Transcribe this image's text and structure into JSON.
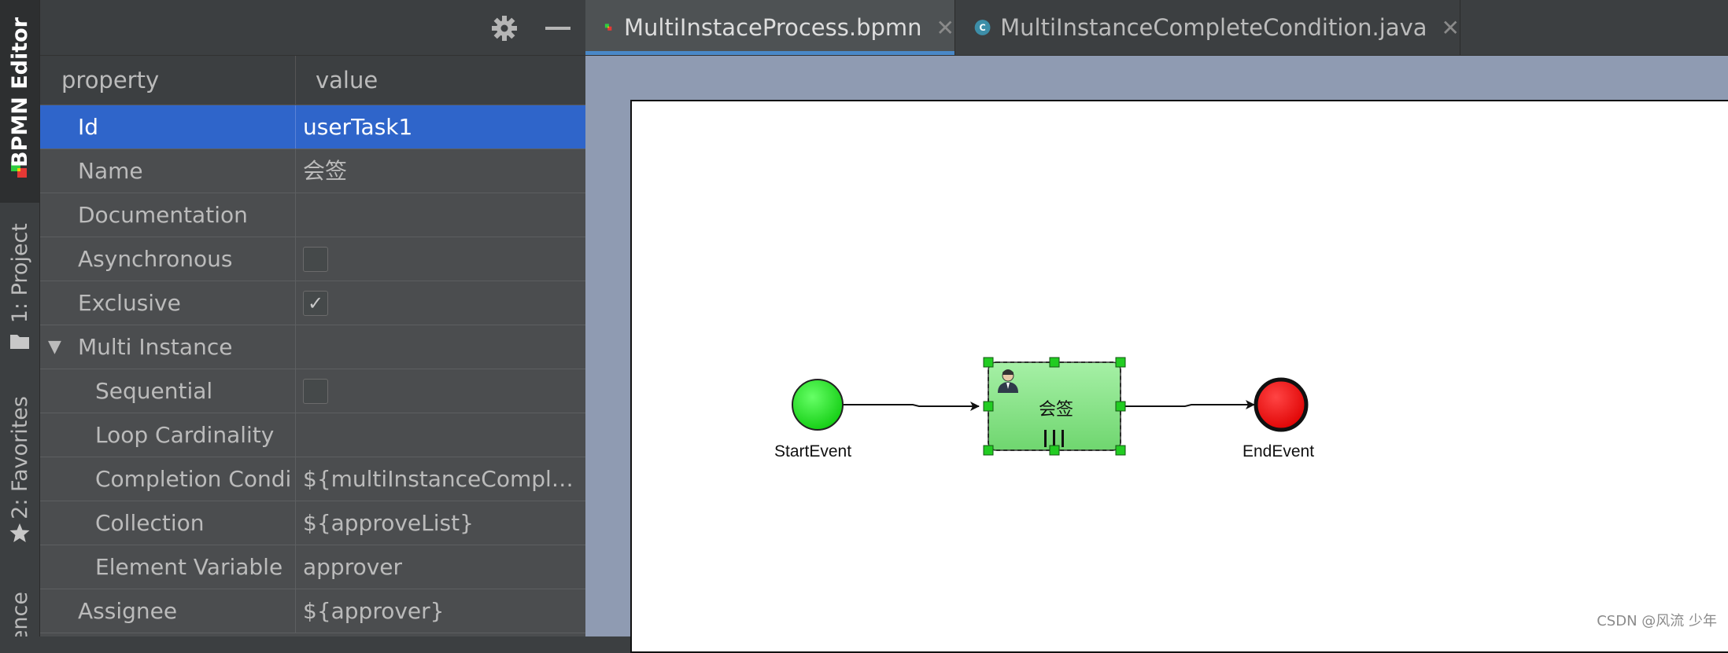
{
  "toolwindows": {
    "bpmn_editor": "BPMN Editor",
    "project": "1: Project",
    "favorites": "2: Favorites",
    "partial": "ence"
  },
  "panel": {
    "col_property": "property",
    "col_value": "value",
    "rows": [
      {
        "name": "Id",
        "value": "userTask1",
        "selected": true
      },
      {
        "name": "Name",
        "value": "会签"
      },
      {
        "name": "Documentation",
        "value": ""
      },
      {
        "name": "Asynchronous",
        "checkbox": false
      },
      {
        "name": "Exclusive",
        "checkbox": true
      },
      {
        "name": "Multi Instance",
        "value": ""
      },
      {
        "name": "Sequential",
        "checkbox": false
      },
      {
        "name": "Loop Cardinality",
        "value": ""
      },
      {
        "name": "Completion Condi",
        "value": "${multiInstanceComplet..."
      },
      {
        "name": "Collection",
        "value": "${approveList}"
      },
      {
        "name": "Element Variable",
        "value": "approver"
      },
      {
        "name": "Assignee",
        "value": "${approver}"
      }
    ]
  },
  "tabs": [
    {
      "label": "MultiInstaceProcess.bpmn",
      "icon": "bpmn-icon",
      "active": true
    },
    {
      "label": "MultiInstanceCompleteCondition.java",
      "icon": "class-c-icon",
      "active": false
    }
  ],
  "diagram": {
    "start_label": "StartEvent",
    "task_label": "会签",
    "end_label": "EndEvent"
  },
  "colors": {
    "selection": "#2f65ca",
    "start_fill": "#22dd22",
    "end_fill": "#ee0000",
    "task_fill": "#8ee68e",
    "handle": "#22cc22"
  },
  "watermark": "CSDN @风流 少年"
}
